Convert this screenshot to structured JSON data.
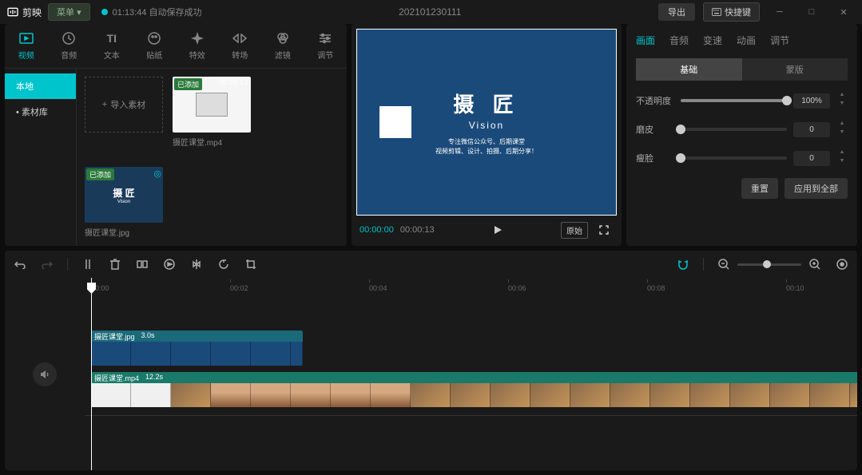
{
  "titlebar": {
    "app_name": "剪映",
    "menu_label": "菜单",
    "save_time": "01:13:44",
    "save_status": "自动保存成功",
    "project_name": "202101230111",
    "export_label": "导出",
    "shortcut_label": "快捷键"
  },
  "media_tabs": [
    {
      "label": "视频",
      "active": true
    },
    {
      "label": "音频",
      "active": false
    },
    {
      "label": "文本",
      "active": false
    },
    {
      "label": "贴纸",
      "active": false
    },
    {
      "label": "特效",
      "active": false
    },
    {
      "label": "转场",
      "active": false
    },
    {
      "label": "滤镜",
      "active": false
    },
    {
      "label": "调节",
      "active": false
    }
  ],
  "media_sidebar": [
    {
      "label": "本地",
      "active": true,
      "dot": false
    },
    {
      "label": "素材库",
      "active": false,
      "dot": true
    }
  ],
  "import_label": "导入素材",
  "media_items": [
    {
      "title": "摄匠课堂.mp4",
      "badge": "已添加",
      "duration": "00:00:13",
      "kind": "white"
    },
    {
      "title": "摄匠课堂.jpg",
      "badge": "已添加",
      "duration": "",
      "kind": "blue"
    }
  ],
  "preview": {
    "big_text": "摄 匠",
    "sub_text": "Vision",
    "small_1": "专注微信公众号、后期课堂",
    "small_2": "视频剪辑、设计、拍摄、后期分享！",
    "time_current": "00:00:00",
    "time_duration": "00:00:13",
    "ratio_label": "原始"
  },
  "props": {
    "tabs": [
      {
        "label": "画面",
        "active": true
      },
      {
        "label": "音频",
        "active": false
      },
      {
        "label": "变速",
        "active": false
      },
      {
        "label": "动画",
        "active": false
      },
      {
        "label": "调节",
        "active": false
      }
    ],
    "subtabs": [
      {
        "label": "基础",
        "active": true
      },
      {
        "label": "蒙版",
        "active": false
      }
    ],
    "opacity_label": "不透明度",
    "opacity_value": "100%",
    "smooth_label": "磨皮",
    "smooth_value": "0",
    "slim_label": "瘦脸",
    "slim_value": "0",
    "reset_label": "重置",
    "apply_all_label": "应用到全部"
  },
  "ruler_ticks": [
    "00:00",
    "00:02",
    "00:04",
    "00:06",
    "00:08",
    "00:10"
  ],
  "clips": [
    {
      "name": "摄匠课堂.jpg",
      "duration": "3.0s"
    },
    {
      "name": "摄匠课堂.mp4",
      "duration": "12.2s"
    }
  ]
}
